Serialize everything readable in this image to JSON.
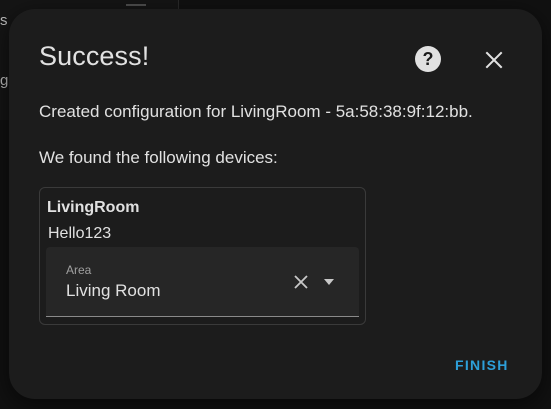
{
  "background": {
    "partial_text_top": "s",
    "partial_text_mid": "g"
  },
  "dialog": {
    "title": "Success!",
    "help_icon": "help-circle-icon",
    "close_icon": "close-icon",
    "message": "Created configuration for LivingRoom - 5a:58:38:9f:12:bb.",
    "devices_intro": "We found the following devices:",
    "devices": [
      {
        "name": "LivingRoom",
        "model": "Hello123",
        "area": {
          "label": "Area",
          "value": "Living Room"
        }
      }
    ],
    "finish_label": "FINISH"
  },
  "colors": {
    "dialog_bg": "#1c1c1c",
    "text": "#e1e1e1",
    "accent": "#2d9fd9"
  }
}
